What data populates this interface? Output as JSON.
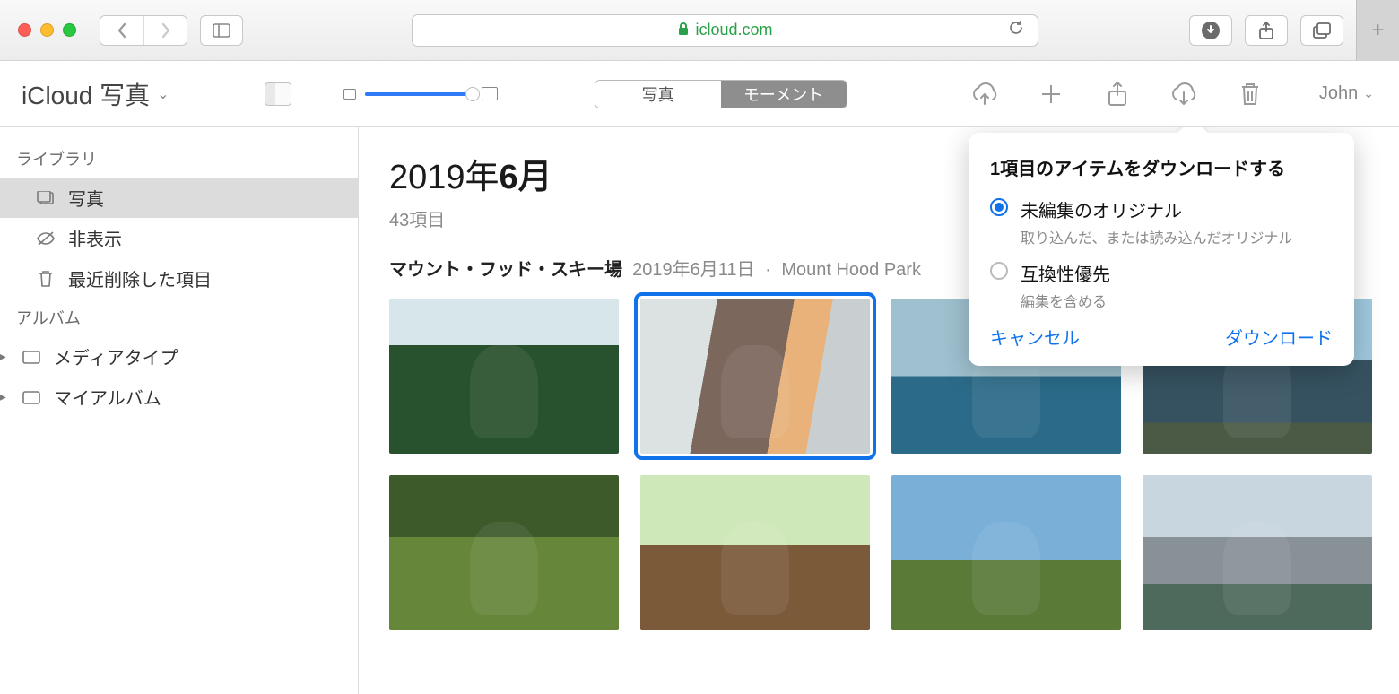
{
  "browser": {
    "url_display": "icloud.com"
  },
  "app": {
    "title": "iCloud 写真",
    "segment": {
      "photos": "写真",
      "moments": "モーメント"
    },
    "user": "John"
  },
  "sidebar": {
    "library_header": "ライブラリ",
    "items": [
      {
        "label": "写真"
      },
      {
        "label": "非表示"
      },
      {
        "label": "最近削除した項目"
      }
    ],
    "albums_header": "アルバム",
    "album_groups": [
      {
        "label": "メディアタイプ"
      },
      {
        "label": "マイアルバム"
      }
    ]
  },
  "content": {
    "year_prefix": "2019年",
    "month": "6月",
    "count_label": "43項目",
    "location_title": "マウント・フッド・スキー場",
    "location_date": "2019年6月11日",
    "location_place": "Mount Hood Park"
  },
  "popover": {
    "title": "1項目のアイテムをダウンロードする",
    "opt1": {
      "label": "未編集のオリジナル",
      "desc": "取り込んだ、または読み込んだオリジナル"
    },
    "opt2": {
      "label": "互換性優先",
      "desc": "編集を含める"
    },
    "cancel": "キャンセル",
    "download": "ダウンロード"
  }
}
